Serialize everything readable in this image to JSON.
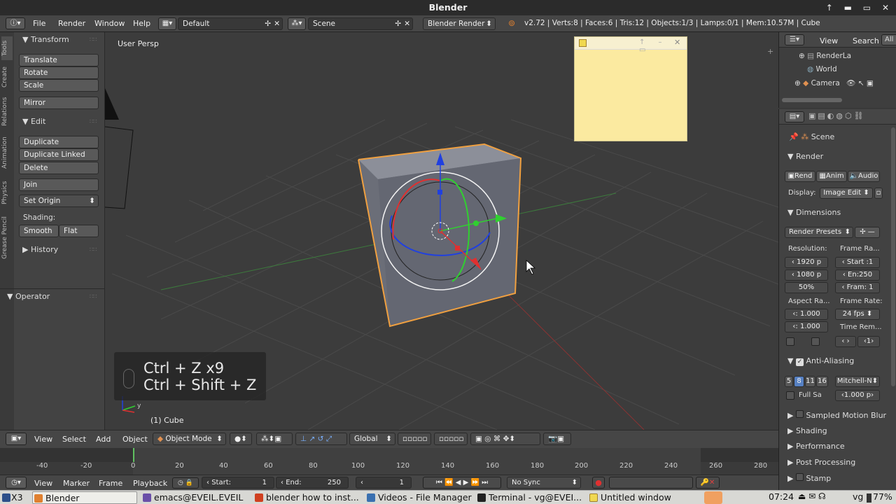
{
  "window": {
    "title": "Blender"
  },
  "menubar": {
    "items": [
      "File",
      "Render",
      "Window",
      "Help"
    ],
    "screen_layout": "Default",
    "scene": "Scene",
    "render_engine": "Blender Render",
    "stats": "v2.72 | Verts:8 | Faces:6 | Tris:12 | Objects:1/3 | Lamps:0/1 | Mem:10.57M | Cube"
  },
  "toolshelf": {
    "tabs": [
      "Tools",
      "Create",
      "Relations",
      "Animation",
      "Physics",
      "Grease Pencil"
    ],
    "transform_header": "Transform",
    "translate": "Translate",
    "rotate": "Rotate",
    "scale": "Scale",
    "mirror": "Mirror",
    "edit_header": "Edit",
    "duplicate": "Duplicate",
    "duplicate_linked": "Duplicate Linked",
    "delete": "Delete",
    "join": "Join",
    "set_origin": "Set Origin",
    "shading_label": "Shading:",
    "smooth": "Smooth",
    "flat": "Flat",
    "history_header": "History",
    "operator_header": "Operator"
  },
  "viewport": {
    "view_label": "User Persp",
    "object_label": "(1) Cube",
    "key_line1": "Ctrl + Z x9",
    "key_line2": "Ctrl + Shift + Z"
  },
  "view3d_header": {
    "view": "View",
    "select": "Select",
    "add": "Add",
    "object": "Object",
    "mode": "Object Mode",
    "orientation": "Global"
  },
  "timeline": {
    "ticks": [
      "-40",
      "-20",
      "0",
      "20",
      "40",
      "60",
      "80",
      "100",
      "120",
      "140",
      "160",
      "180",
      "200",
      "220",
      "240",
      "260",
      "280"
    ],
    "view": "View",
    "marker": "Marker",
    "frame": "Frame",
    "playback": "Playback",
    "start_label": "Start:",
    "start_value": "1",
    "end_label": "End:",
    "end_value": "250",
    "current_frame": "1",
    "sync": "No Sync"
  },
  "outliner": {
    "view": "View",
    "search": "Search",
    "all_scenes": "All S",
    "items": [
      "RenderLa",
      "World",
      "Camera"
    ]
  },
  "properties": {
    "context": "Scene",
    "render_header": "Render",
    "render_btn": "Rend",
    "anim_btn": "Anim",
    "audio_btn": "Audio",
    "display_label": "Display:",
    "display_value": "Image Edit",
    "dimensions_header": "Dimensions",
    "render_presets": "Render Presets",
    "resolution_label": "Resolution:",
    "frame_range_label": "Frame Ra...",
    "res_x": "1920 p",
    "res_y": "1080 p",
    "res_pct": "50%",
    "start": "Start :1",
    "end": "En:250",
    "step": "Fram: 1",
    "aspect_label": "Aspect Ra...",
    "frame_rate_label": "Frame Rate:",
    "aspect_x": ": 1.000",
    "aspect_y": ": 1.000",
    "fps": "24 fps",
    "time_remap_label": "Time Rem...",
    "time_remap_value": "1",
    "aa_header": "Anti-Aliasing",
    "aa_samples": [
      "5",
      "8",
      "11",
      "16"
    ],
    "aa_filter": "Mitchell-N",
    "full_sample": "Full Sa",
    "filter_size": "1.000 p",
    "sampled_motion_blur": "Sampled Motion Blur",
    "shading": "Shading",
    "performance": "Performance",
    "post_processing": "Post Processing",
    "stamp": "Stamp"
  },
  "taskbar": {
    "x3": "X3",
    "blender": "Blender",
    "emacs": "emacs@EVEIL.EVEIL",
    "browser": "blender how to inst...",
    "files": "Videos - File Manager",
    "terminal": "Terminal - vg@EVEI...",
    "untitled": "Untitled window",
    "time": "07:24",
    "user": "vg",
    "battery": "77%"
  },
  "colors": {
    "selection_outline": "#f0a040",
    "x_axis": "#e03030",
    "y_axis": "#30d030",
    "z_axis": "#2040e0"
  }
}
